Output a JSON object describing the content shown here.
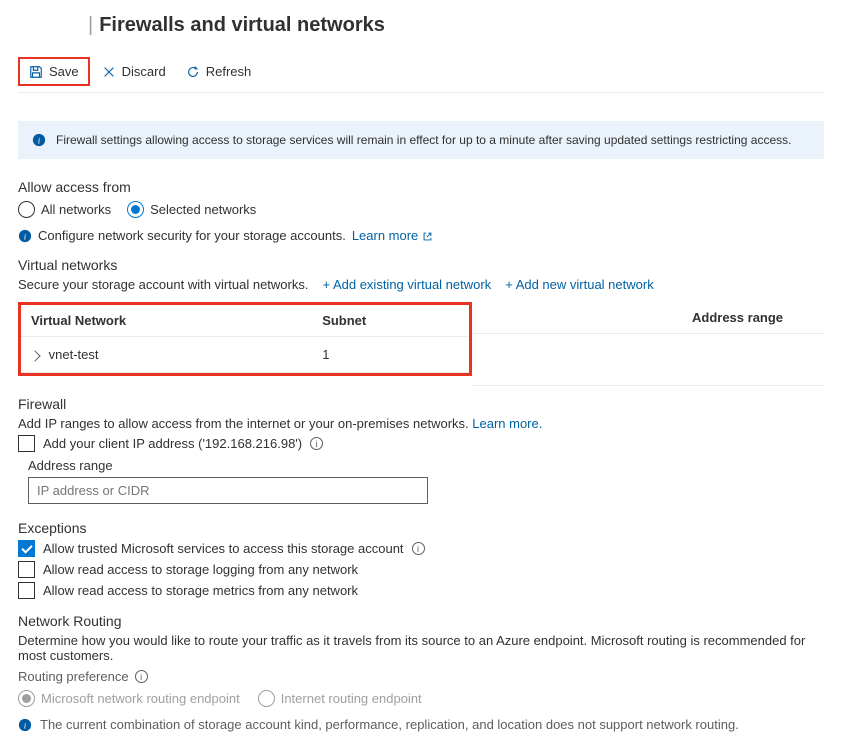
{
  "page": {
    "title": "Firewalls and virtual networks"
  },
  "toolbar": {
    "save": "Save",
    "discard": "Discard",
    "refresh": "Refresh"
  },
  "banner": {
    "message": "Firewall settings allowing access to storage services will remain in effect for up to a minute after saving updated settings restricting access."
  },
  "access": {
    "heading": "Allow access from",
    "all": "All networks",
    "selected": "Selected networks",
    "configLine": "Configure network security for your storage accounts.",
    "learnMore": "Learn more"
  },
  "vnets": {
    "heading": "Virtual networks",
    "secureText": "Secure your storage account with virtual networks.",
    "addExisting": "+ Add existing virtual network",
    "addNew": "+ Add new virtual network",
    "col1": "Virtual Network",
    "col2": "Subnet",
    "col3": "Address range",
    "rows": [
      {
        "name": "vnet-test",
        "subnet": "1"
      }
    ]
  },
  "firewall": {
    "heading": "Firewall",
    "desc": "Add IP ranges to allow access from the internet or your on-premises networks.",
    "learnMore": "Learn more.",
    "clientIp": "Add your client IP address ('192.168.216.98')",
    "addressRangeLabel": "Address range",
    "placeholder": "IP address or CIDR"
  },
  "exceptions": {
    "heading": "Exceptions",
    "trusted": "Allow trusted Microsoft services to access this storage account",
    "logging": "Allow read access to storage logging from any network",
    "metrics": "Allow read access to storage metrics from any network"
  },
  "routing": {
    "heading": "Network Routing",
    "desc": "Determine how you would like to route your traffic as it travels from its source to an Azure endpoint. Microsoft routing is recommended for most customers.",
    "prefLabel": "Routing preference",
    "microsoft": "Microsoft network routing endpoint",
    "internet": "Internet routing endpoint",
    "warning": "The current combination of storage account kind, performance, replication, and location does not support network routing."
  }
}
